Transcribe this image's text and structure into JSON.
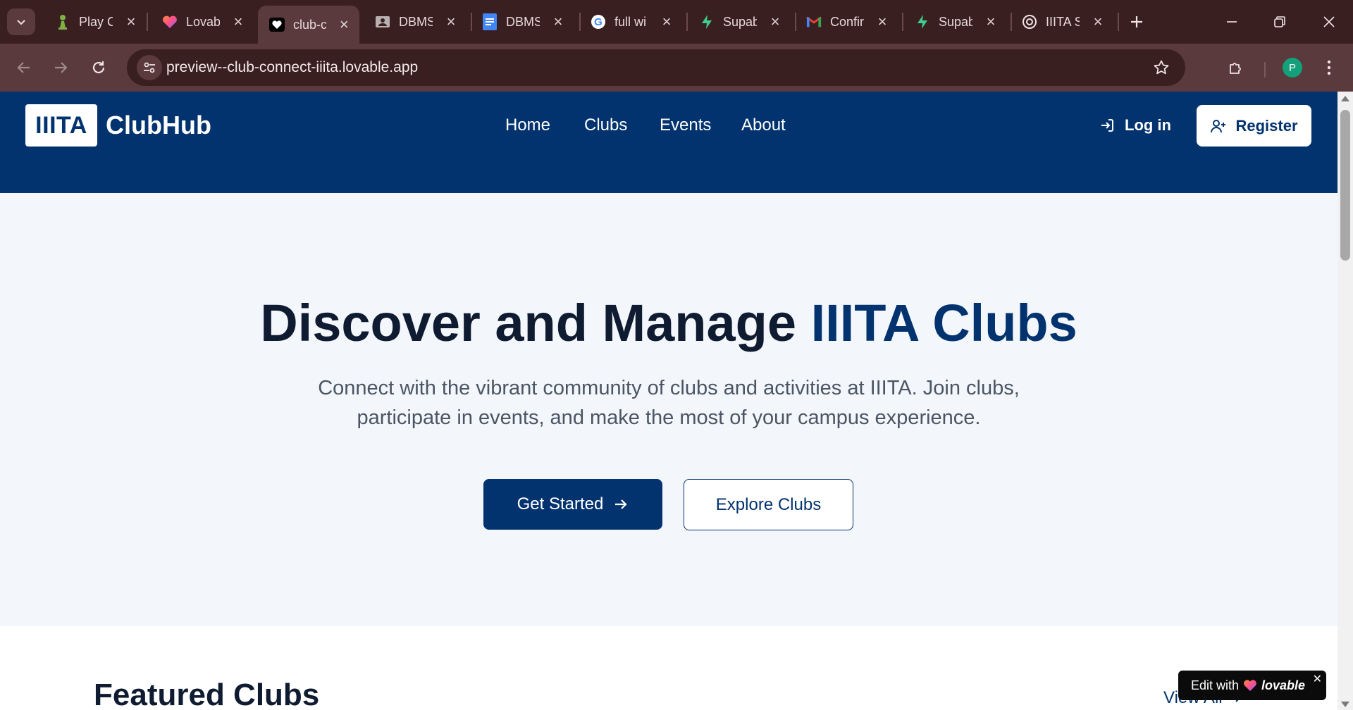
{
  "browser": {
    "tabs": [
      {
        "title": "Play C",
        "icon": "chess-pawn-icon",
        "active": false
      },
      {
        "title": "Lovab",
        "icon": "lovable-heart-icon",
        "active": false
      },
      {
        "title": "club-c",
        "icon": "heart-icon",
        "active": true
      },
      {
        "title": "DBMS",
        "icon": "contact-card-icon",
        "active": false
      },
      {
        "title": "DBMS",
        "icon": "google-docs-icon",
        "active": false
      },
      {
        "title": "full wi",
        "icon": "google-icon",
        "active": false
      },
      {
        "title": "Supab",
        "icon": "supabase-icon",
        "active": false
      },
      {
        "title": "Confir",
        "icon": "gmail-icon",
        "active": false
      },
      {
        "title": "Supab",
        "icon": "supabase-icon",
        "active": false
      },
      {
        "title": "IIITA S",
        "icon": "openai-icon",
        "active": false
      }
    ],
    "url": "preview--club-connect-iiita.lovable.app",
    "profile_initial": "P"
  },
  "site": {
    "logo_mark": "IIITA",
    "logo_text": "ClubHub",
    "nav": {
      "home": "Home",
      "clubs": "Clubs",
      "events": "Events",
      "about": "About"
    },
    "login_label": "Log in",
    "register_label": "Register",
    "colors": {
      "primary": "#02336e",
      "hero_bg": "#f3f7fc",
      "heading": "#0f1b30"
    }
  },
  "hero": {
    "title_part1": "Discover and Manage ",
    "title_accent": "IIITA Clubs",
    "subtitle": "Connect with the vibrant community of clubs and activities at IIITA. Join clubs, participate in events, and make the most of your campus experience.",
    "primary_button": "Get Started",
    "secondary_button": "Explore Clubs"
  },
  "featured": {
    "title": "Featured Clubs",
    "view_all": "View All"
  },
  "lovable_badge": {
    "prefix": "Edit with",
    "brand": "lovable"
  }
}
